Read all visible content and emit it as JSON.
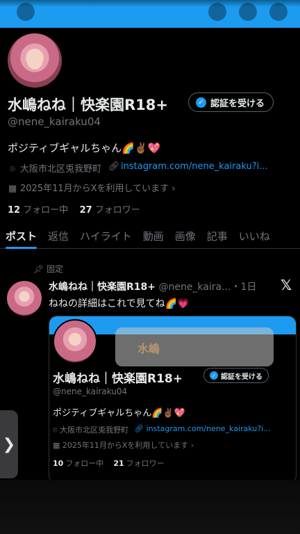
{
  "profile": {
    "name": "水嶋ねね｜快楽園R18+",
    "verify_label": "認証を受ける",
    "handle": "@nene_kairaku04",
    "bio": "ポジティブギャルちゃん🌈✌🏾💖",
    "location": "大阪市北区兎我野町",
    "link": "instagram.com/nene_kairaku?i...",
    "joined": "2025年11月からXを利用しています",
    "following_count": "12",
    "following_label": "フォロー中",
    "followers_count": "27",
    "followers_label": "フォロワー"
  },
  "tabs": [
    "ポスト",
    "返信",
    "ハイライト",
    "動画",
    "画像",
    "記事",
    "いいね"
  ],
  "pinned_post": {
    "pinned_label": "固定",
    "author": "水嶋ねね｜快楽園R18+",
    "handle_time": "@nene_kaira...・1日",
    "text": "ねねの詳細はこれで見てね🌈💗",
    "embed": {
      "name": "水嶋ねね｜快楽園R18+",
      "verify_label": "認証を受ける",
      "handle": "@nene_kairaku04",
      "bio": "ポジティブギャルちゃん🌈✌🏾💖",
      "location": "大阪市北区兎我野町",
      "link": "instagram.com/nene_kairaku?i...",
      "joined": "2025年11月からXを利用しています",
      "following_count": "10",
      "following_label": "フォロー中",
      "followers_count": "21",
      "followers_label": "フォロワー",
      "overlay_text": "水嶋"
    }
  },
  "icons": {
    "location": "location-pin-icon",
    "link": "link-icon",
    "calendar": "calendar-icon",
    "pin": "pin-icon",
    "x_logo": "x-logo-icon",
    "side_arrow": "chevron-right-icon"
  },
  "colors": {
    "accent": "#1d9bf0",
    "background": "#000000",
    "text": "#e7e9ea",
    "muted": "#71767b"
  }
}
